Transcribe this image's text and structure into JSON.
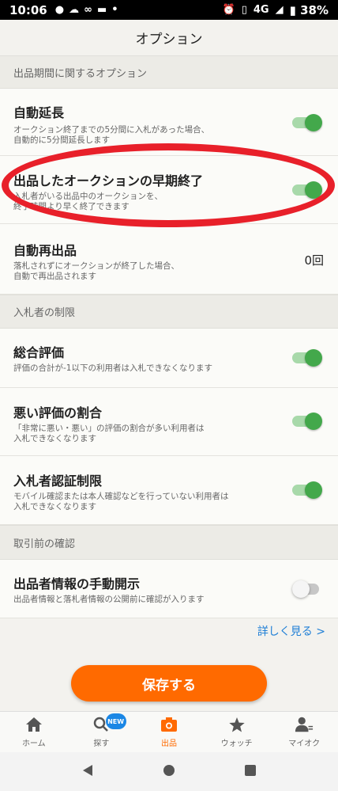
{
  "status": {
    "time": "10:06",
    "network": "4G",
    "battery": "38%"
  },
  "header": {
    "title": "オプション"
  },
  "sections": {
    "period": "出品期間に関するオプション",
    "bidders": "入札者の制限",
    "pretrade": "取引前の確認"
  },
  "options": {
    "auto_extend": {
      "title": "自動延長",
      "desc1": "オークション終了までの5分間に入札があった場合、",
      "desc2": "自動的に5分間延長します",
      "enabled": true
    },
    "early_end": {
      "title": "出品したオークションの早期終了",
      "desc1": "入札者がいる出品中のオークションを、",
      "desc2": "終了時間より早く終了できます",
      "enabled": true
    },
    "auto_relist": {
      "title": "自動再出品",
      "desc1": "落札されずにオークションが終了した場合、",
      "desc2": "自動で再出品されます",
      "value": "0回"
    },
    "total_rating": {
      "title": "総合評価",
      "desc1": "評価の合計が-1以下の利用者は入札できなくなります",
      "enabled": true
    },
    "bad_ratio": {
      "title": "悪い評価の割合",
      "desc1": "「非常に悪い・悪い」の評価の割合が多い利用者は",
      "desc2": "入札できなくなります",
      "enabled": true
    },
    "verification": {
      "title": "入札者認証制限",
      "desc1": "モバイル確認または本人確認などを行っていない利用者は",
      "desc2": "入札できなくなります",
      "enabled": true
    },
    "manual_disclosure": {
      "title": "出品者情報の手動開示",
      "desc1": "出品者情報と落札者情報の公開前に確認が入ります",
      "enabled": false
    }
  },
  "details_link": "詳しく見る >",
  "save_label": "保存する",
  "tabs": {
    "home": "ホーム",
    "search": "探す",
    "sell": "出品",
    "watch": "ウォッチ",
    "mypage": "マイオク",
    "new_badge": "NEW"
  },
  "colors": {
    "accent": "#ff6a00",
    "toggle_on": "#43a84b",
    "link": "#1f7fd6",
    "annotation": "#e8202a"
  }
}
